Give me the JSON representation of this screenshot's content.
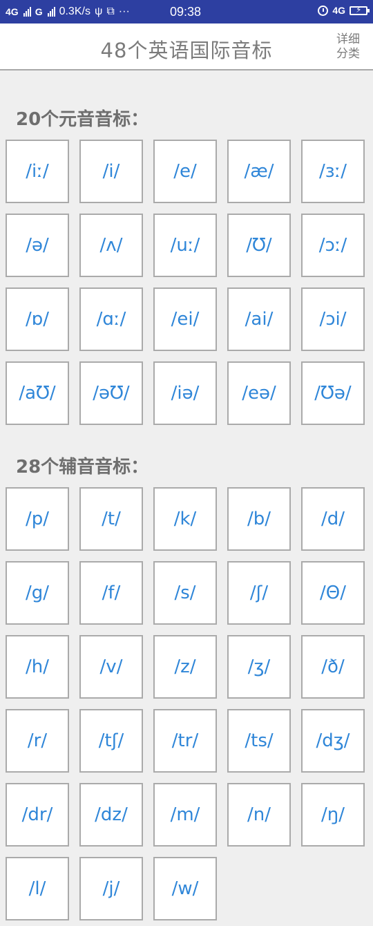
{
  "status_bar": {
    "network1": "4G",
    "network2": "G",
    "speed": "0.3K/s",
    "time": "09:38",
    "network_right": "4G",
    "more": "···"
  },
  "header": {
    "title": "48个英语国际音标",
    "detail_line1": "详细",
    "detail_line2": "分类"
  },
  "vowels": {
    "heading": "20个元音音标：",
    "items": [
      "/iː/",
      "/i/",
      "/e/",
      "/æ/",
      "/ɜː/",
      "/ə/",
      "/ʌ/",
      "/uː/",
      "/Ʊ/",
      "/ɔː/",
      "/ɒ/",
      "/ɑː/",
      "/ei/",
      "/ai/",
      "/ɔi/",
      "/aƱ/",
      "/əƱ/",
      "/iə/",
      "/eə/",
      "/Ʊə/"
    ]
  },
  "consonants": {
    "heading": "28个辅音音标：",
    "items": [
      "/p/",
      "/t/",
      "/k/",
      "/b/",
      "/d/",
      "/g/",
      "/f/",
      "/s/",
      "/ʃ/",
      "/Θ/",
      "/h/",
      "/v/",
      "/z/",
      "/ʒ/",
      "/ð/",
      "/r/",
      "/tʃ/",
      "/tr/",
      "/ts/",
      "/dʒ/",
      "/dr/",
      "/dz/",
      "/m/",
      "/n/",
      "/ŋ/",
      "/l/",
      "/j/",
      "/w/"
    ]
  },
  "colors": {
    "status_bar": "#2d3fa1",
    "accent_text": "#2f86d8",
    "background": "#efefef"
  }
}
